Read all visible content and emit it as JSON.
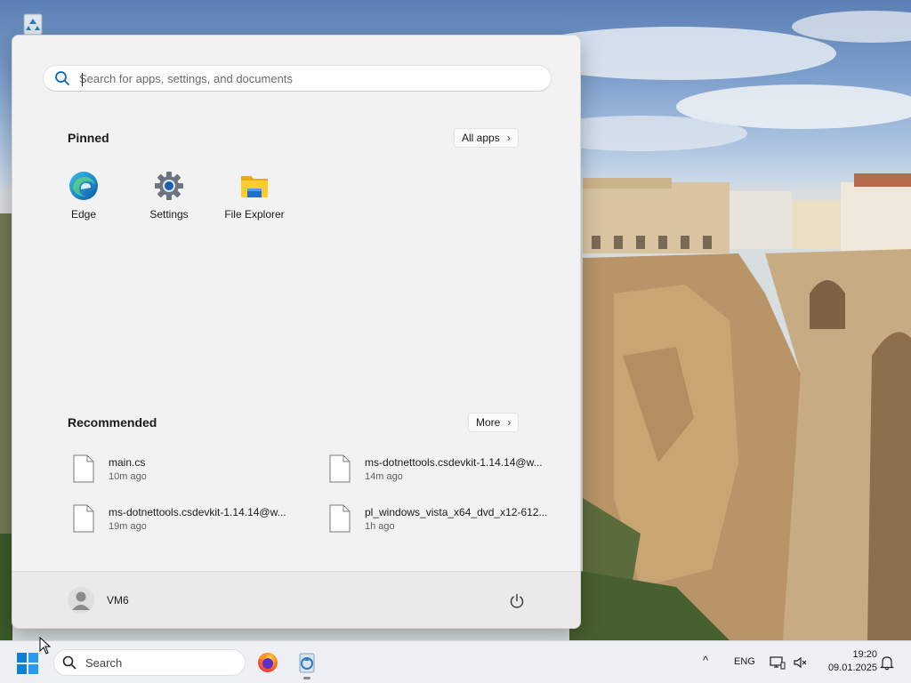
{
  "start_menu": {
    "search": {
      "placeholder": "Search for apps, settings, and documents"
    },
    "pinned": {
      "title": "Pinned",
      "all_apps_label": "All apps",
      "apps": [
        {
          "label": "Edge",
          "icon": "edge-icon"
        },
        {
          "label": "Settings",
          "icon": "settings-gear-icon"
        },
        {
          "label": "File Explorer",
          "icon": "folder-icon"
        }
      ]
    },
    "recommended": {
      "title": "Recommended",
      "more_label": "More",
      "items": [
        {
          "name": "main.cs",
          "time": "10m ago"
        },
        {
          "name": "ms-dotnettools.csdevkit-1.14.14@w...",
          "time": "14m ago"
        },
        {
          "name": "ms-dotnettools.csdevkit-1.14.14@w...",
          "time": "19m ago"
        },
        {
          "name": "pl_windows_vista_x64_dvd_x12-612...",
          "time": "1h ago"
        }
      ]
    },
    "footer": {
      "user_name": "VM6",
      "power_icon": "power-icon"
    }
  },
  "taskbar": {
    "search_label": "Search",
    "pinned_apps": [
      "firefox-icon",
      "recycle-tool-icon"
    ],
    "tray": {
      "chevron": "^",
      "language": "ENG",
      "time": "19:20",
      "date": "09.01.2025"
    }
  },
  "colors": {
    "start_bg": "#f2f2f2",
    "taskbar_bg": "#eef0f3",
    "accent": "#0067c0"
  }
}
